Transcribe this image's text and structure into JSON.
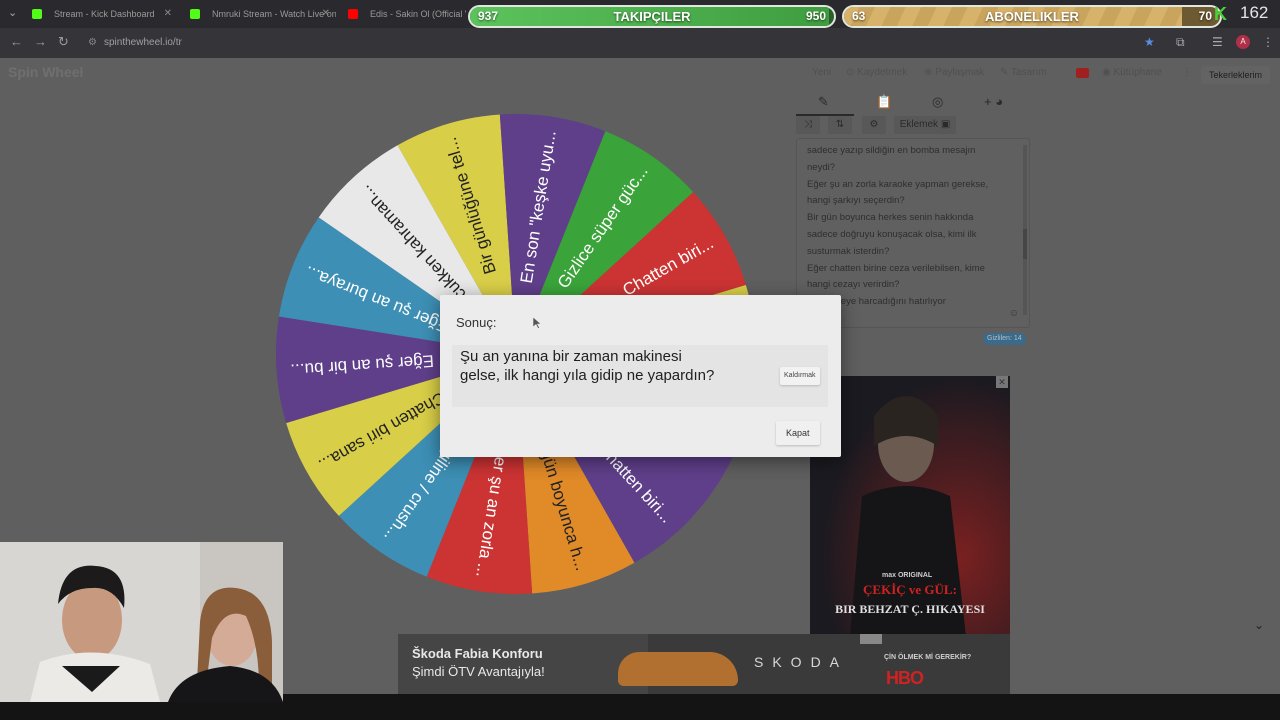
{
  "browser": {
    "tabs": [
      {
        "title": "Stream - Kick Dashboard",
        "favicon_color": "#53fc18"
      },
      {
        "title": "Nmruki Stream - Watch Live on",
        "favicon_color": "#53fc18"
      },
      {
        "title": "Edis - Sakin Ol (Official Vid",
        "favicon_color": "#ff0000"
      }
    ],
    "url": "spinthewheel.io/tr"
  },
  "overlay": {
    "followers": {
      "label": "TAKIPÇILER",
      "current": "937",
      "goal": "950",
      "progress": 0.985
    },
    "subscribers": {
      "label": "ABONELIKLER",
      "current": "63",
      "goal": "70",
      "progress": 0.9
    },
    "viewer_count": "162"
  },
  "app": {
    "brand": "Spin Wheel",
    "menu": {
      "new": "Yeni",
      "save": "Kaydetmek",
      "share": "Paylaşmak",
      "design": "Tasarım",
      "library": "Kütüphane",
      "wheels": "Tekerleklerim"
    },
    "editor_tools": {
      "add_label": "Eklemek"
    },
    "entries": [
      "sadece yazıp sildiğin en bomba mesajın",
      "neydi?",
      "Eğer şu an zorla karaoke yapman gerekse,",
      "hangi şarkıyı seçerdin?",
      "Bir gün boyunca herkes senin hakkında",
      "sadece doğruyu konuşacak olsa, kimi ilk",
      "susturmak isterdin?",
      "Eğer chatten birine ceza verilebilsen, kime",
      "hangi cezayı verirdin?",
      "...ısını neye harcadığını hatırlıyor"
    ],
    "hidden_badge": "Gizlilen: 14"
  },
  "wheel": {
    "segments": [
      {
        "label": "Bir günlüğüne tel...",
        "color": "#d8ce48"
      },
      {
        "label": "En son \"keşke uyu...",
        "color": "#5f3f8a"
      },
      {
        "label": "Gizlice süper güc...",
        "color": "#3aa43a"
      },
      {
        "label": "Chatten biri...",
        "color": "#cc3333"
      },
      {
        "label": "",
        "color": "#d8ce48"
      },
      {
        "label": "",
        "color": "#5f3f8a"
      },
      {
        "label": "Chatten biri...",
        "color": "#5f3f8a"
      },
      {
        "label": "Bir gün boyunca h...",
        "color": "#e08a28"
      },
      {
        "label": "Eğer şu an zorla ...",
        "color": "#cc3333"
      },
      {
        "label": "...ygiline / crush...",
        "color": "#3d8fb5"
      },
      {
        "label": "Chatten biri sana...",
        "color": "#d8ce48"
      },
      {
        "label": "Eğer şu an bir bu...",
        "color": "#5f3f8a"
      },
      {
        "label": "Eğer şu an buraya...",
        "color": "#3d8fb5"
      },
      {
        "label": "Çocukken kahraman...",
        "color": "#e8e8e8"
      }
    ]
  },
  "modal": {
    "title": "Sonuç:",
    "result": "Şu an yanına bir zaman makinesi gelse, ilk hangi yıla gidip ne yapardın?",
    "remove_label": "Kaldırmak",
    "close_label": "Kapat"
  },
  "ads": {
    "poster": {
      "tag": "max ORIGINAL",
      "title_line1": "ÇEKİÇ ve GÜL:",
      "title_line2": "BIR BEHZAT Ç. HIKAYESI"
    },
    "banner": {
      "headline": "Škoda Fabia Konforu",
      "subline": "Şimdi ÖTV Avantajıyla!",
      "brand": "SKODA",
      "tagline": "ÇİN ÖLMEK Mİ GEREKİR?",
      "network": "HBO"
    }
  }
}
